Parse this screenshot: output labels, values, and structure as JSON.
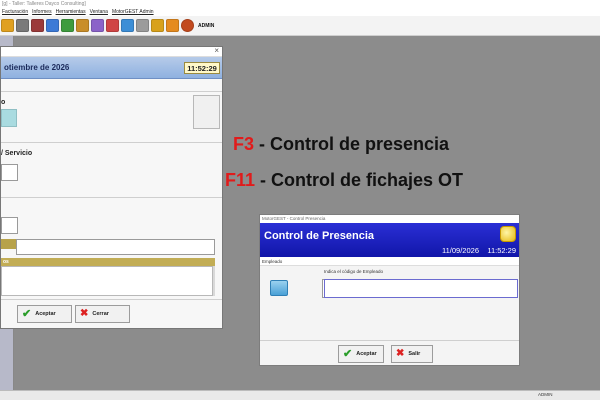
{
  "window": {
    "title": "[g] - Taller: Talleres Dayco Consulting]"
  },
  "menu": {
    "items": [
      "Facturación",
      "Informes",
      "Herramientas",
      "Ventana",
      "MotorGEST Admin"
    ]
  },
  "toolbar": {
    "user_label": "ADMIN",
    "icons": [
      "folder-icon",
      "gear-icon",
      "cut-icon",
      "tools-icon",
      "document-icon",
      "document-icon",
      "note-icon",
      "calendar-icon",
      "table-icon",
      "document-icon",
      "image-icon",
      "lock-icon",
      "user-icon"
    ],
    "colors": [
      "#e0a020",
      "#7a7a7a",
      "#9b3a3a",
      "#3c7ad6",
      "#3e9b3e",
      "#c98e2a",
      "#8b63c9",
      "#d04545",
      "#3c8ed6",
      "#9b9b9b",
      "#d8a11b",
      "#e58b1f",
      "#c24a1e"
    ]
  },
  "left_dialog": {
    "date_text": "otiembre de 2026",
    "time": "11:52:29",
    "label_o": "o",
    "label_servicio": "/ Servicio",
    "tag_os": "os",
    "accept_label": "Aceptar",
    "close_label": "Cerrar"
  },
  "shortcuts": [
    {
      "key": "F3",
      "text": " - Control de presencia"
    },
    {
      "key": "F11",
      "text": " - Control de fichajes OT"
    }
  ],
  "presence_dialog": {
    "window_title": "MotorGEST - Control Presencia",
    "header_title": "Control de Presencia",
    "date": "11/09/2026",
    "time": "11:52:29",
    "section_label": "Empleado",
    "field_label": "Indica el código de Empleado",
    "code_value": "",
    "name_value": "",
    "accept_label": "Aceptar",
    "exit_label": "Salir"
  },
  "statusbar": {
    "user": "ADMIN"
  }
}
